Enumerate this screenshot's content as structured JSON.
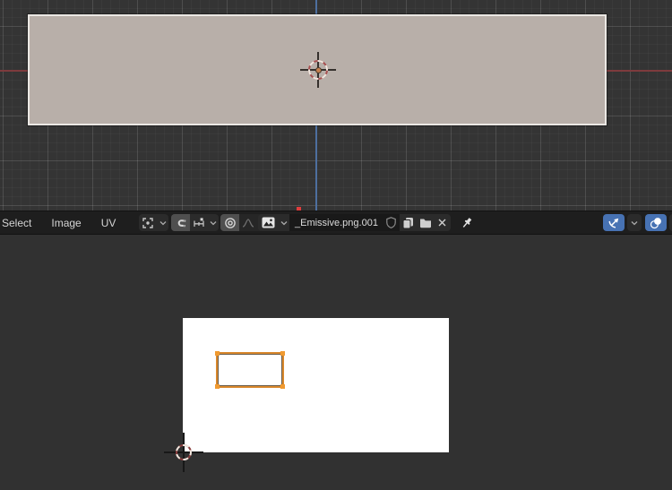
{
  "header": {
    "menus": [
      {
        "label": "Select"
      },
      {
        "label": "Image"
      },
      {
        "label": "UV"
      }
    ],
    "image_field": {
      "value": "_Emissive.png.001"
    },
    "icons": [
      "pivot-point-icon",
      "chevron-down-icon",
      "snap-magnet-icon",
      "snap-increment-icon",
      "proportional-editing-icon",
      "falloff-curve-icon",
      "image-browse-icon",
      "shield-fake-user-icon",
      "copy-pages-icon",
      "folder-open-icon",
      "unlink-x-icon",
      "pin-icon",
      "gizmo-icon",
      "overlays-icon"
    ]
  },
  "viewport": {
    "object": "selected-plane",
    "cursor": "3d-cursor",
    "axes": {
      "horizontal": "x-axis-red",
      "vertical": "z-axis-blue"
    }
  },
  "image_editor": {
    "image": "white-image",
    "selection": "uv-rectangle",
    "cursor": "2d-cursor"
  },
  "colors": {
    "accent_blue": "#4772b3",
    "uv_orange": "#d9882c",
    "uv_corner_orange": "#f09a30",
    "axis_red": "#7e3b3d",
    "axis_blue": "#4e6f9f",
    "plane_fill": "#b8afa9",
    "plane_outline": "#ebe8e4",
    "header_bg": "#1e1e1e",
    "viewport_bg": "#343434",
    "editor_bg": "#313131",
    "image_white": "#ffffff",
    "red_marker": "#e13c3c"
  }
}
